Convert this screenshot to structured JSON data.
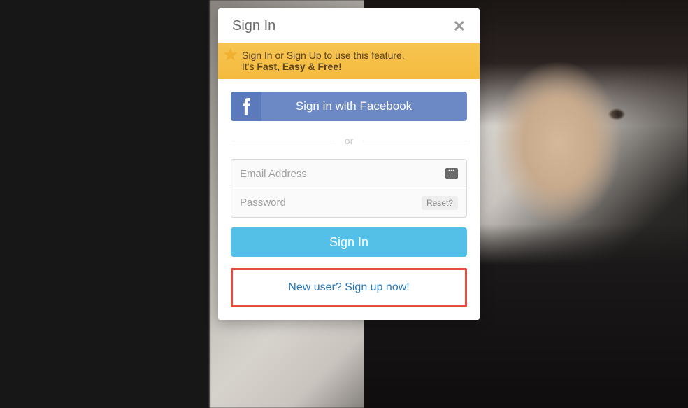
{
  "modal": {
    "title": "Sign In",
    "close_symbol": "✕",
    "banner": {
      "line1": "Sign In or Sign Up to use this feature.",
      "line2_prefix": "It's ",
      "line2_bold": "Fast, Easy & Free!"
    },
    "facebook": {
      "label": "Sign in with Facebook"
    },
    "divider": {
      "text": "or"
    },
    "email": {
      "placeholder": "Email Address"
    },
    "password": {
      "placeholder": "Password",
      "reset_label": "Reset?"
    },
    "signin_button": {
      "label": "Sign In"
    },
    "signup": {
      "label": "New user? Sign up now!"
    }
  }
}
